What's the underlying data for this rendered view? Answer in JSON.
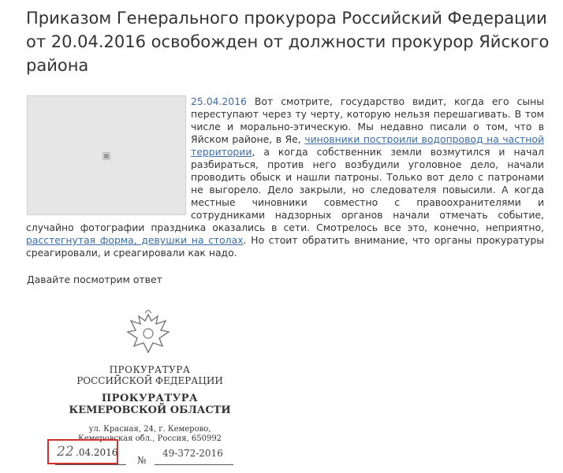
{
  "title": "Приказом Генерального прокурора Российский Федерации от 20.04.2016 освобожден от должности прокурор Яйского района",
  "article": {
    "date": "25.04.2016",
    "text_1": " Вот смотрите, государство видит, когда его сыны переступают через ту черту, которую нельзя перешагивать. В том числе и морально-этическую. Мы недавно писали о том, что в Яйском районе, в Яе, ",
    "link_1": "чиновники построили водопровод на частной территории",
    "text_2": ", а когда собственник земли возмутился и начал разбираться, против него возбудили уголовное дело, начали проводить обыск и нашли патроны. Только вот дело с патронами не выгорело. Дело закрыли, но следователя повысили. А когда местные чиновники совместно с правоохранителями и сотрудниками надзорных органов начали отмечать событие, случайно фотографии праздника оказались в сети. Смотрелось все это, конечно, неприятно, ",
    "link_2": "расстегнутая форма, девушки на столах",
    "text_3": ". Но стоит обратить внимание, что органы прокуратуры среагировали, и среагировали как надо."
  },
  "cta": "Давайте посмотрим ответ",
  "letterhead": {
    "org_line_1": "ПРОКУРАТУРА",
    "org_line_2": "РОССИЙСКОЙ ФЕДЕРАЦИИ",
    "org_line_3": "ПРОКУРАТУРА",
    "org_line_4": "КЕМЕРОВСКОЙ ОБЛАСТИ",
    "address_1": "ул. Красная, 24, г. Кемерово,",
    "address_2": "Кемеровская обл., Россия, 650992",
    "date_handwritten": "22",
    "date_printed": ".04.2016",
    "no_mark": "№",
    "number": "49-372-2016"
  },
  "colors": {
    "link": "#3a6ca8",
    "highlight_box": "#d0302e"
  }
}
